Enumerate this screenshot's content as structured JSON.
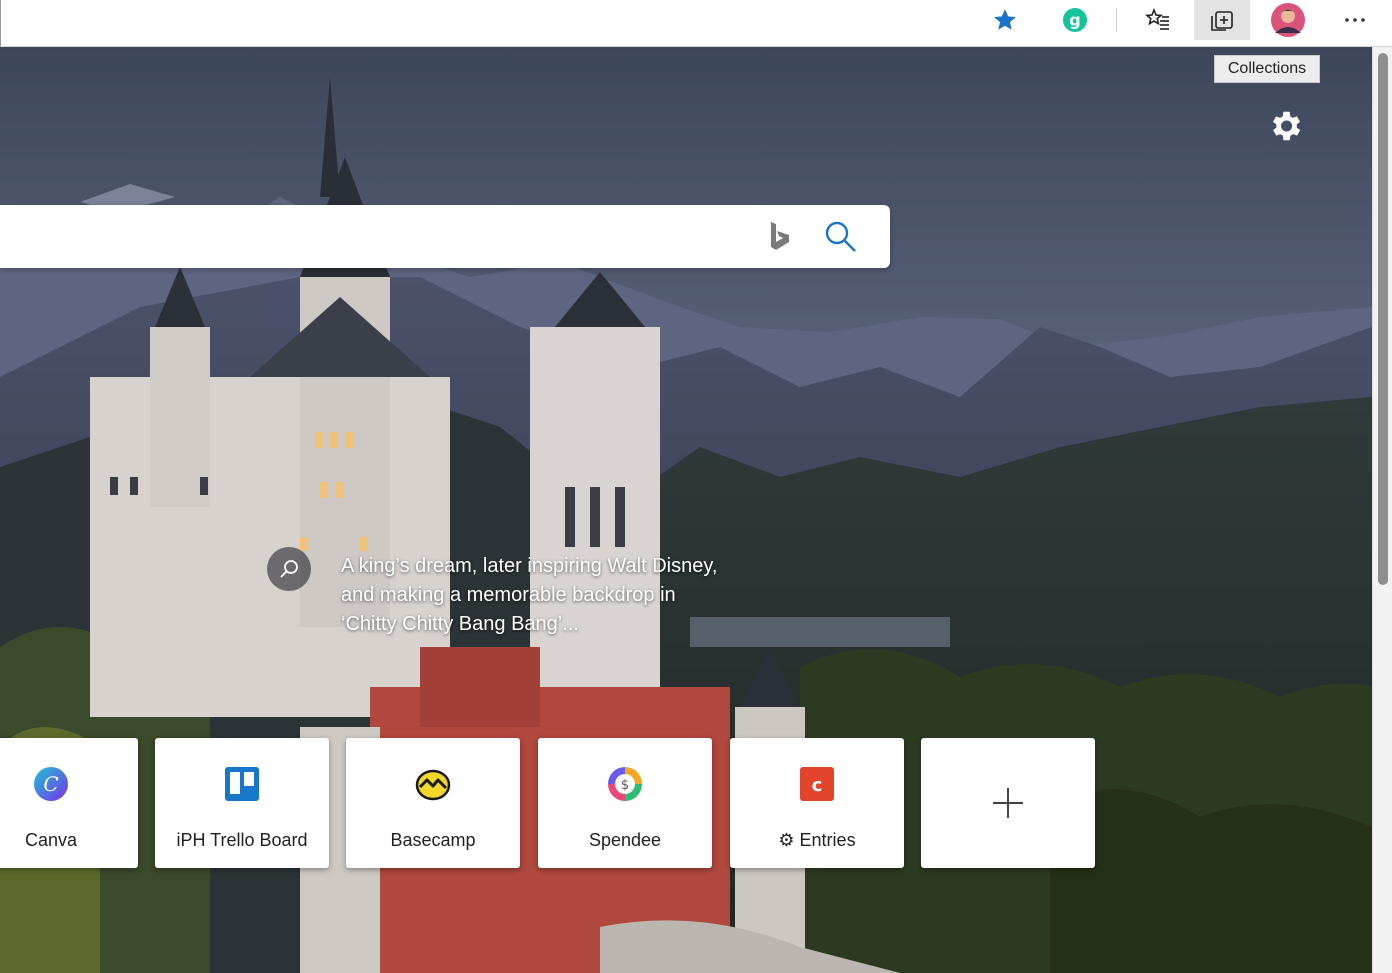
{
  "toolbar": {
    "tooltip": "Collections",
    "icons": [
      "favorite-star-icon",
      "grammarly-icon",
      "favorites-list-icon",
      "collections-icon",
      "profile-avatar",
      "more-options-icon"
    ]
  },
  "search": {
    "placeholder": "",
    "value": ""
  },
  "caption": {
    "text": "A king’s dream, later inspiring Walt Disney, and making a memorable backdrop in ‘Chitty Chitty Bang Bang’..."
  },
  "quick_links": [
    {
      "label": "Canva",
      "color": "#5b3ce8"
    },
    {
      "label": "iPH Trello Board",
      "color": "#1877c9"
    },
    {
      "label": "Basecamp",
      "color": "#f1d72a"
    },
    {
      "label": "Spendee",
      "color": "#2ebc72"
    },
    {
      "label": "⚙ Entries",
      "color": "#e3442c"
    }
  ],
  "colors": {
    "accent_blue": "#1a73c9",
    "grammarly": "#15c39a"
  }
}
